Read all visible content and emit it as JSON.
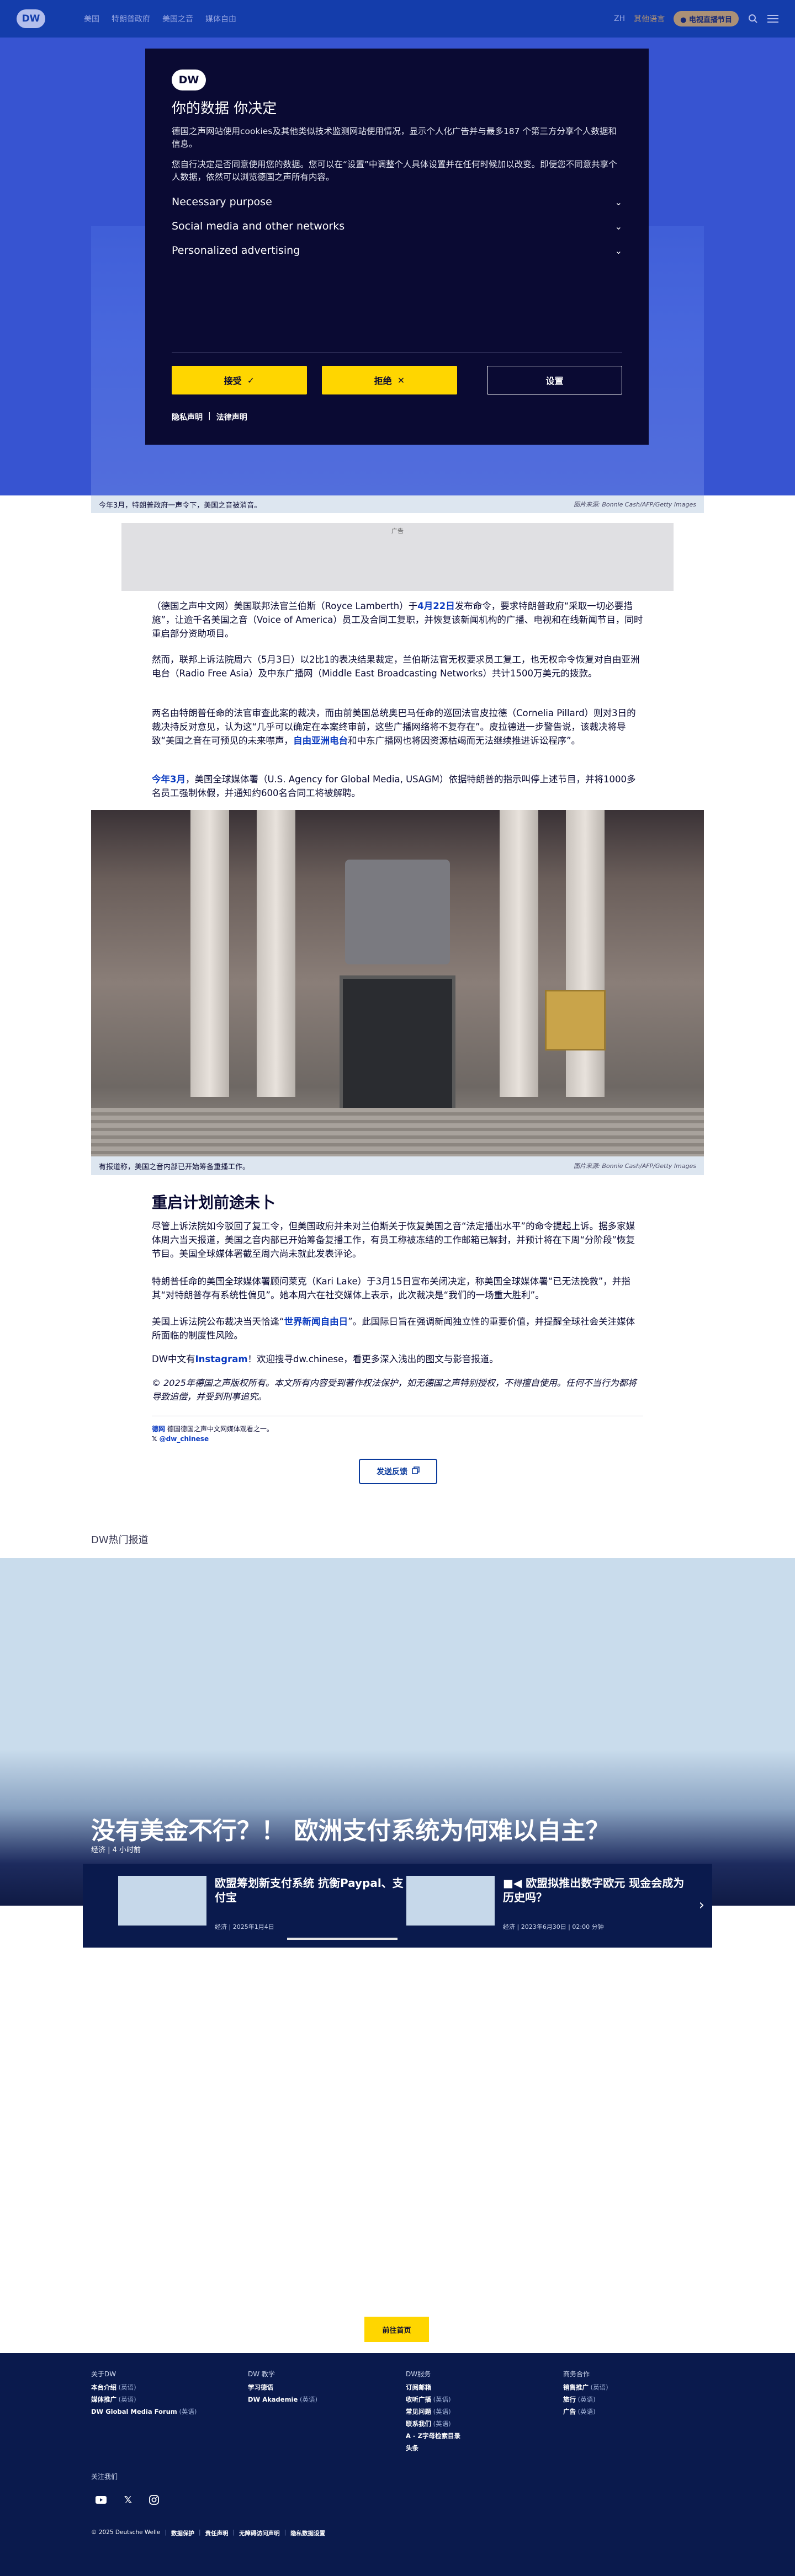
{
  "header": {
    "logo": "DW",
    "nav": [
      "美国",
      "特朗普政府",
      "美国之音",
      "媒体自由"
    ],
    "lang": "ZH",
    "others": "其他语言",
    "live": "● 电视直播节目"
  },
  "hero": {
    "caption": "今年3月，特朗普政府一声令下，美国之音被消音。",
    "credit": "图片来源: Bonnie Cash/AFP/Getty Images"
  },
  "ad": {
    "label": "广告"
  },
  "article": {
    "p1_pre": "（德国之声中文网）美国联邦法官兰伯斯（Royce Lamberth）于",
    "p1_link": "4月22日",
    "p1_post": "发布命令，要求特朗普政府“采取一切必要措施”，让逾千名美国之音（Voice of America）员工及合同工复职，并恢复该新闻机构的广播、电视和在线新闻节目，同时重启部分资助项目。",
    "p2": "然而，联邦上诉法院周六（5月3日）以2比1的表决结果裁定，兰伯斯法官无权要求员工复工，也无权命令恢复对自由亚洲电台（Radio Free Asia）及中东广播网（Middle East Broadcasting Networks）共计1500万美元的拨款。",
    "p3_pre": "两名由特朗普任命的法官审查此案的裁决，而由前美国总统奥巴马任命的巡回法官皮拉德（Cornelia Pillard）则对3日的裁决持反对意见，认为这“几乎可以确定在本案终审前，这些广播网络将不复存在”。皮拉德进一步警告说，该裁决将导致“美国之音在可预见的未来噤声，",
    "p3_link": "自由亚洲电台",
    "p3_post": "和中东广播网也将因资源枯竭而无法继续推进诉讼程序”。",
    "p4_link": "今年3月",
    "p4_post": "，美国全球媒体署（U.S. Agency for Global Media, USAGM）依据特朗普的指示叫停上述节目，并将1000多名员工强制休假，并通知约600名合同工将被解聘。",
    "photo_caption": "有报道称，美国之音内部已开始筹备重播工作。",
    "photo_credit": "图片来源: Bonnie Cash/AFP/Getty Images",
    "h2": "重启计划前途未卜",
    "p5": "尽管上诉法院如今驳回了复工令，但美国政府并未对兰伯斯关于恢复美国之音“法定播出水平”的命令提起上诉。据多家媒体周六当天报道，美国之音内部已开始筹备复播工作，有员工称被冻结的工作邮箱已解封，并预计将在下周“分阶段”恢复节目。美国全球媒体署截至周六尚未就此发表评论。",
    "p6": "特朗普任命的美国全球媒体署顾问莱克（Kari Lake）于3月15日宣布关闭决定，称美国全球媒体署“已无法挽救”，并指其“对特朗普存有系统性偏见”。她本周六在社交媒体上表示，此次裁决是“我们的一场重大胜利”。",
    "p7_pre": "美国上诉法院公布裁决当天恰逢“",
    "p7_link": "世界新闻自由日",
    "p7_post": "”。此国际日旨在强调新闻独立性的重要价值，并提醒全球社会关注媒体所面临的制度性风险。",
    "p8_pre": "DW中文有",
    "p8_link": "Instagram",
    "p8_post": "！欢迎搜寻dw.chinese，看更多深入浅出的图文与影音报道。",
    "disclaimer": "© 2025年德国之声版权所有。本文所有内容受到著作权法保护，如无德国之声特别授权，不得擅自使用。任何不当行为都将导致追偿，并受到刑事追究。",
    "soc1_b": "德网",
    "soc1": " 德国德国之声中文网媒体观看之一。",
    "soc2": "@dw_chinese",
    "feedback": "发送反馈"
  },
  "section": {
    "title": "DW热门报道"
  },
  "feature": {
    "title": "没有美金不行？！ 欧洲支付系统为何难以自主？",
    "meta": "经济 | 4 小时前",
    "cards": [
      {
        "title": "欧盟筹划新支付系统 抗衡Paypal、支付宝",
        "meta": "经济 | 2025年1月4日"
      },
      {
        "title": "欧盟拟推出数字欧元 现金会成为历史吗？",
        "meta": "经济 | 2023年6月30日 | 02:00 分钟",
        "icon": "video-icon"
      }
    ]
  },
  "totop": "前往首页",
  "footer": {
    "cols": [
      {
        "h": "关于DW",
        "items": [
          {
            "t": "本台介绍",
            "s": "(英语)"
          },
          {
            "t": "媒体推广",
            "s": "(英语)"
          },
          {
            "t": "DW Global Media Forum",
            "s": "(英语)"
          }
        ]
      },
      {
        "h": "DW 教学",
        "items": [
          {
            "t": "学习德语",
            "s": ""
          },
          {
            "t": "DW Akademie",
            "s": "(英语)"
          }
        ]
      },
      {
        "h": "DW服务",
        "items": [
          {
            "t": "订阅邮箱",
            "s": ""
          },
          {
            "t": "收听广播",
            "s": "(英语)"
          },
          {
            "t": "常见问题",
            "s": "(英语)"
          },
          {
            "t": "联系我们",
            "s": "(英语)"
          },
          {
            "t": "A - Z字母检索目录",
            "s": ""
          },
          {
            "t": "头条",
            "s": ""
          }
        ]
      },
      {
        "h": "商务合作",
        "items": [
          {
            "t": "销售推广",
            "s": "(英语)"
          },
          {
            "t": "旅行",
            "s": "(英语)"
          },
          {
            "t": "广告",
            "s": "(英语)"
          }
        ]
      }
    ],
    "follow": "关注我们",
    "links": [
      "© 2025 Deutsche Welle",
      "数据保护",
      "责任声明",
      "无障碍访问声明",
      "隐私数据设置"
    ]
  },
  "modal": {
    "logo": "DW",
    "title": "你的数据 你决定",
    "p1": "德国之声网站使用cookies及其他类似技术监测网站使用情况，显示个人化广告并与最多187 个第三方分享个人数据和信息。",
    "p2": "您自行决定是否同意使用您的数据。您可以在“设置”中调整个人具体设置并在任何时候加以改变。即便您不同意共享个人数据，依然可以浏览德国之声所有内容。",
    "accordions": [
      "Necessary purpose",
      "Social media and other networks",
      "Personalized advertising"
    ],
    "accept": "接受",
    "reject": "拒绝",
    "settings": "设置",
    "privacy": "隐私声明",
    "legal": "法律声明"
  },
  "colors": {
    "brand": "#0a3a9c",
    "accent": "#ffd600",
    "dark": "#0a0a33"
  }
}
